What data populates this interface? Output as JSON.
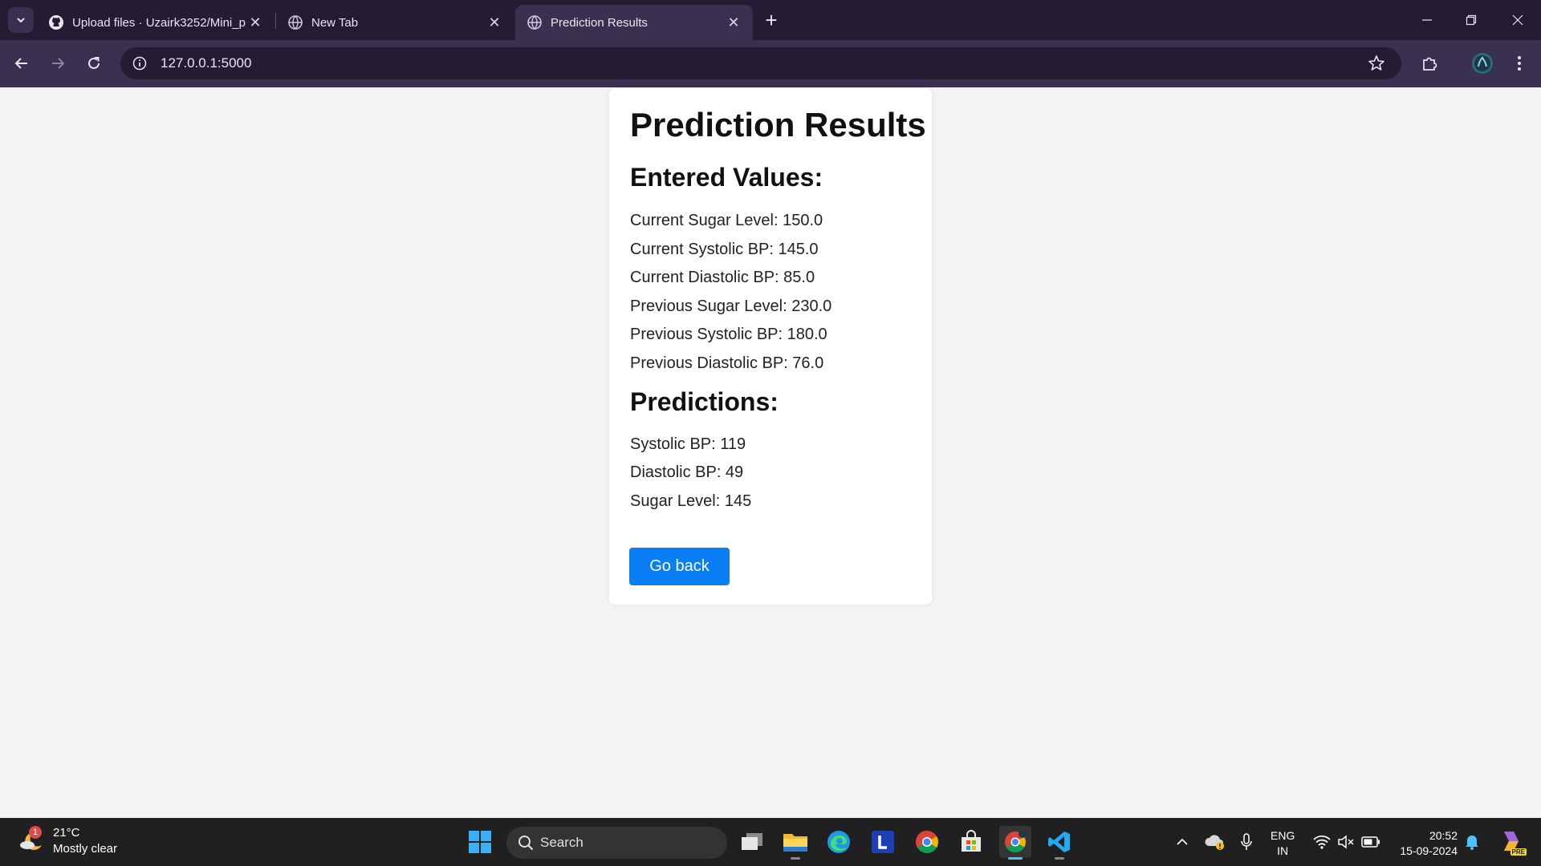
{
  "browser": {
    "tabs": [
      {
        "title": "Upload files · Uzairk3252/Mini_p",
        "favicon": "github-icon",
        "active": false
      },
      {
        "title": "New Tab",
        "favicon": "globe-icon",
        "active": false
      },
      {
        "title": "Prediction Results",
        "favicon": "globe-icon",
        "active": true
      }
    ],
    "url": "127.0.0.1:5000"
  },
  "page": {
    "title": "Prediction Results",
    "entered_heading": "Entered Values:",
    "entered": [
      "Current Sugar Level: 150.0",
      "Current Systolic BP: 145.0",
      "Current Diastolic BP: 85.0",
      "Previous Sugar Level: 230.0",
      "Previous Systolic BP: 180.0",
      "Previous Diastolic BP: 76.0"
    ],
    "predictions_heading": "Predictions:",
    "predictions": [
      "Systolic BP: 119",
      "Diastolic BP: 49",
      "Sugar Level: 145"
    ],
    "back_button": "Go back",
    "accent": "#0a7ef5"
  },
  "taskbar": {
    "weather_temp": "21°C",
    "weather_desc": "Mostly clear",
    "weather_badge": "1",
    "search_label": "Search",
    "lang_line1": "ENG",
    "lang_line2": "IN",
    "time": "20:52",
    "date": "15-09-2024",
    "copilot_badge": "PRE"
  }
}
